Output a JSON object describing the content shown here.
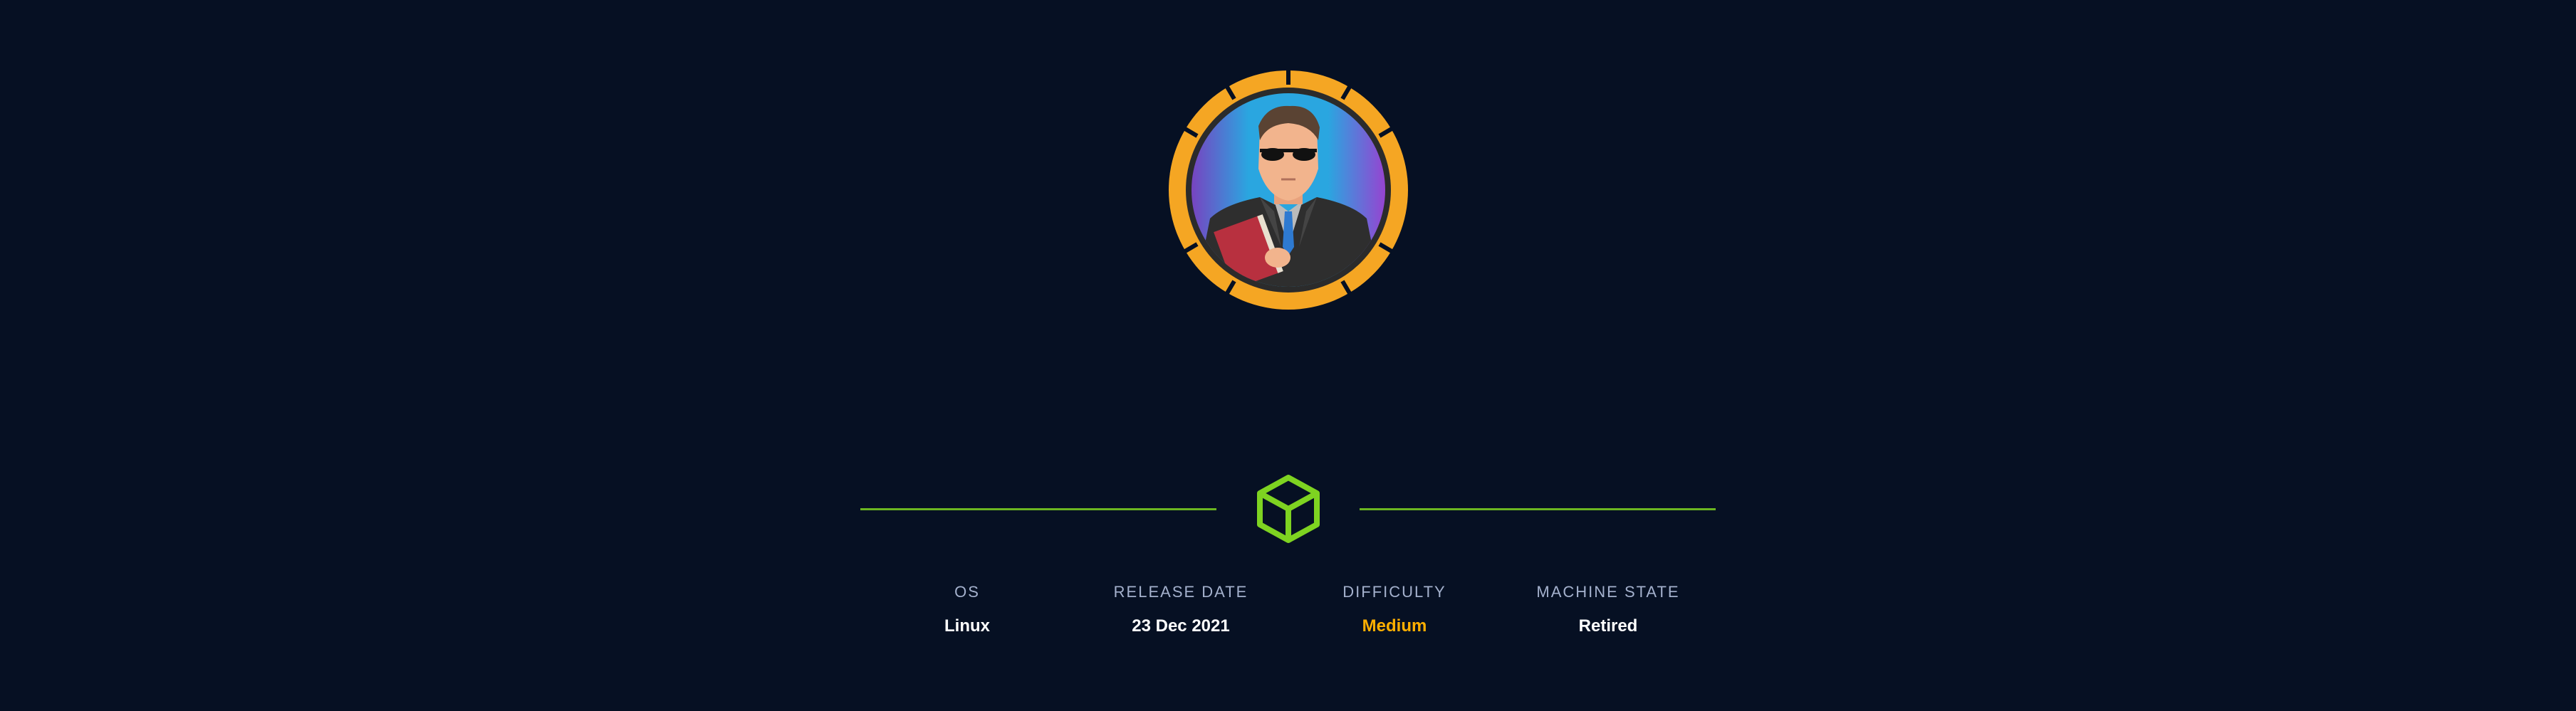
{
  "machine": {
    "stats": [
      {
        "label": "OS",
        "value": "Linux"
      },
      {
        "label": "RELEASE DATE",
        "value": "23 Dec 2021"
      },
      {
        "label": "DIFFICULTY",
        "value": "Medium"
      },
      {
        "label": "MACHINE STATE",
        "value": "Retired"
      }
    ]
  },
  "colors": {
    "background": "#061023",
    "accent_green": "#7ed321",
    "difficulty_medium": "#ffaf00",
    "label_gray": "#a4b1cd",
    "avatar_ring": "#f5a623"
  },
  "icons": {
    "divider_icon": "cube-icon",
    "avatar": "agent-avatar-icon"
  }
}
